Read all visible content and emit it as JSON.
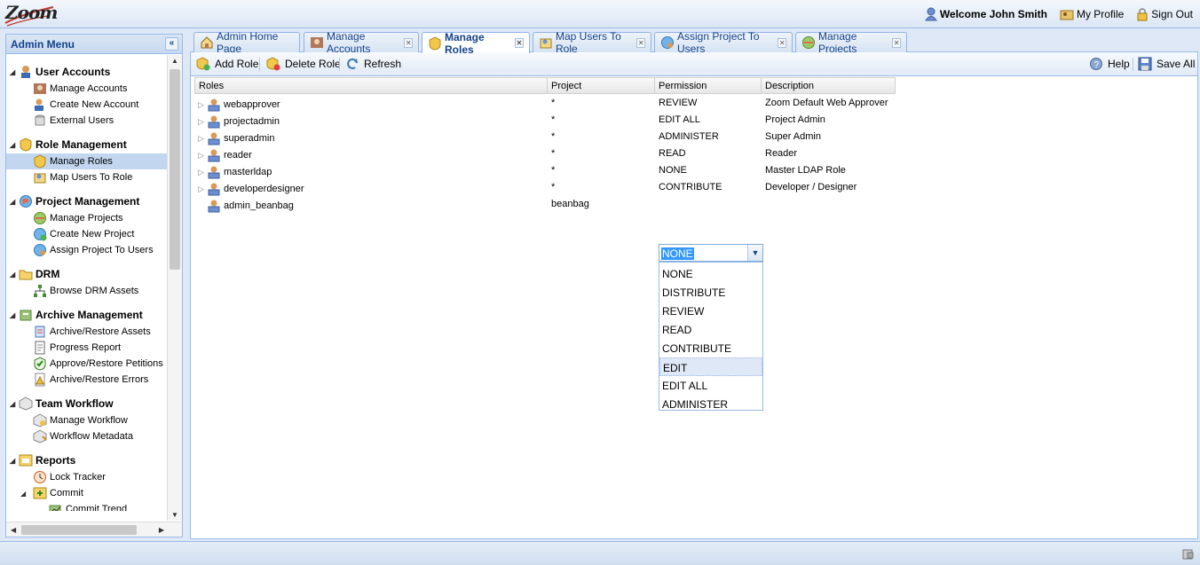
{
  "header": {
    "logo_text": "Zoom",
    "welcome": "Welcome John Smith",
    "my_profile": "My Profile",
    "sign_out": "Sign Out"
  },
  "sidebar": {
    "title": "Admin Menu",
    "groups": [
      {
        "label": "User Accounts",
        "items": [
          "Manage Accounts",
          "Create New Account",
          "External Users"
        ]
      },
      {
        "label": "Role Management",
        "items": [
          "Manage Roles",
          "Map Users To Role"
        ]
      },
      {
        "label": "Project Management",
        "items": [
          "Manage Projects",
          "Create New Project",
          "Assign Project To Users"
        ]
      },
      {
        "label": "DRM",
        "items": [
          "Browse DRM Assets"
        ]
      },
      {
        "label": "Archive Management",
        "items": [
          "Archive/Restore Assets",
          "Progress Report",
          "Approve/Restore Petitions",
          "Archive/Restore Errors"
        ]
      },
      {
        "label": "Team Workflow",
        "items": [
          "Manage Workflow",
          "Workflow Metadata"
        ]
      },
      {
        "label": "Reports",
        "items": [
          "Lock Tracker",
          "Commit",
          "Commit Trend"
        ]
      }
    ]
  },
  "tabs": [
    {
      "label": "Admin Home Page",
      "closable": false
    },
    {
      "label": "Manage Accounts",
      "closable": true
    },
    {
      "label": "Manage Roles",
      "closable": true,
      "active": true
    },
    {
      "label": "Map Users To Role",
      "closable": true
    },
    {
      "label": "Assign Project To Users",
      "closable": true
    },
    {
      "label": "Manage Projects",
      "closable": true
    }
  ],
  "toolbar": {
    "add_role": "Add Role",
    "delete_role": "Delete Role",
    "refresh": "Refresh",
    "help": "Help",
    "save_all": "Save All"
  },
  "grid": {
    "columns": [
      "Roles",
      "Project",
      "Permission",
      "Description"
    ],
    "rows": [
      {
        "role": "webapprover",
        "project": "*",
        "permission": "REVIEW",
        "description": "Zoom Default Web Approver"
      },
      {
        "role": "projectadmin",
        "project": "*",
        "permission": "EDIT ALL",
        "description": "Project Admin"
      },
      {
        "role": "superadmin",
        "project": "*",
        "permission": "ADMINISTER",
        "description": "Super Admin"
      },
      {
        "role": "reader",
        "project": "*",
        "permission": "READ",
        "description": "Reader"
      },
      {
        "role": "masterldap",
        "project": "*",
        "permission": "NONE",
        "description": "Master LDAP Role"
      },
      {
        "role": "developerdesigner",
        "project": "*",
        "permission": "CONTRIBUTE",
        "description": "Developer / Designer"
      },
      {
        "role": "admin_beanbag",
        "project": "beanbag",
        "permission": "",
        "description": ""
      }
    ]
  },
  "permission_combo": {
    "value": "NONE",
    "options": [
      "NONE",
      "DISTRIBUTE",
      "REVIEW",
      "READ",
      "CONTRIBUTE",
      "EDIT",
      "EDIT ALL",
      "ADMINISTER"
    ],
    "highlighted": "EDIT"
  }
}
